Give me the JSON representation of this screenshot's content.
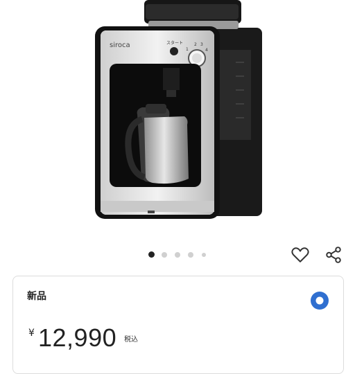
{
  "product": {
    "brand": "siroca",
    "start_label": "スタート",
    "dial_marks": [
      "2",
      "3",
      "4",
      "1"
    ]
  },
  "gallery": {
    "total": 5,
    "current": 1
  },
  "actions": {
    "like_icon": "heart-icon",
    "share_icon": "share-icon"
  },
  "listing": {
    "condition": "新品",
    "currency": "¥",
    "price": "12,990",
    "tax_label": "税込"
  },
  "colors": {
    "accent": "#2f6fd0"
  }
}
